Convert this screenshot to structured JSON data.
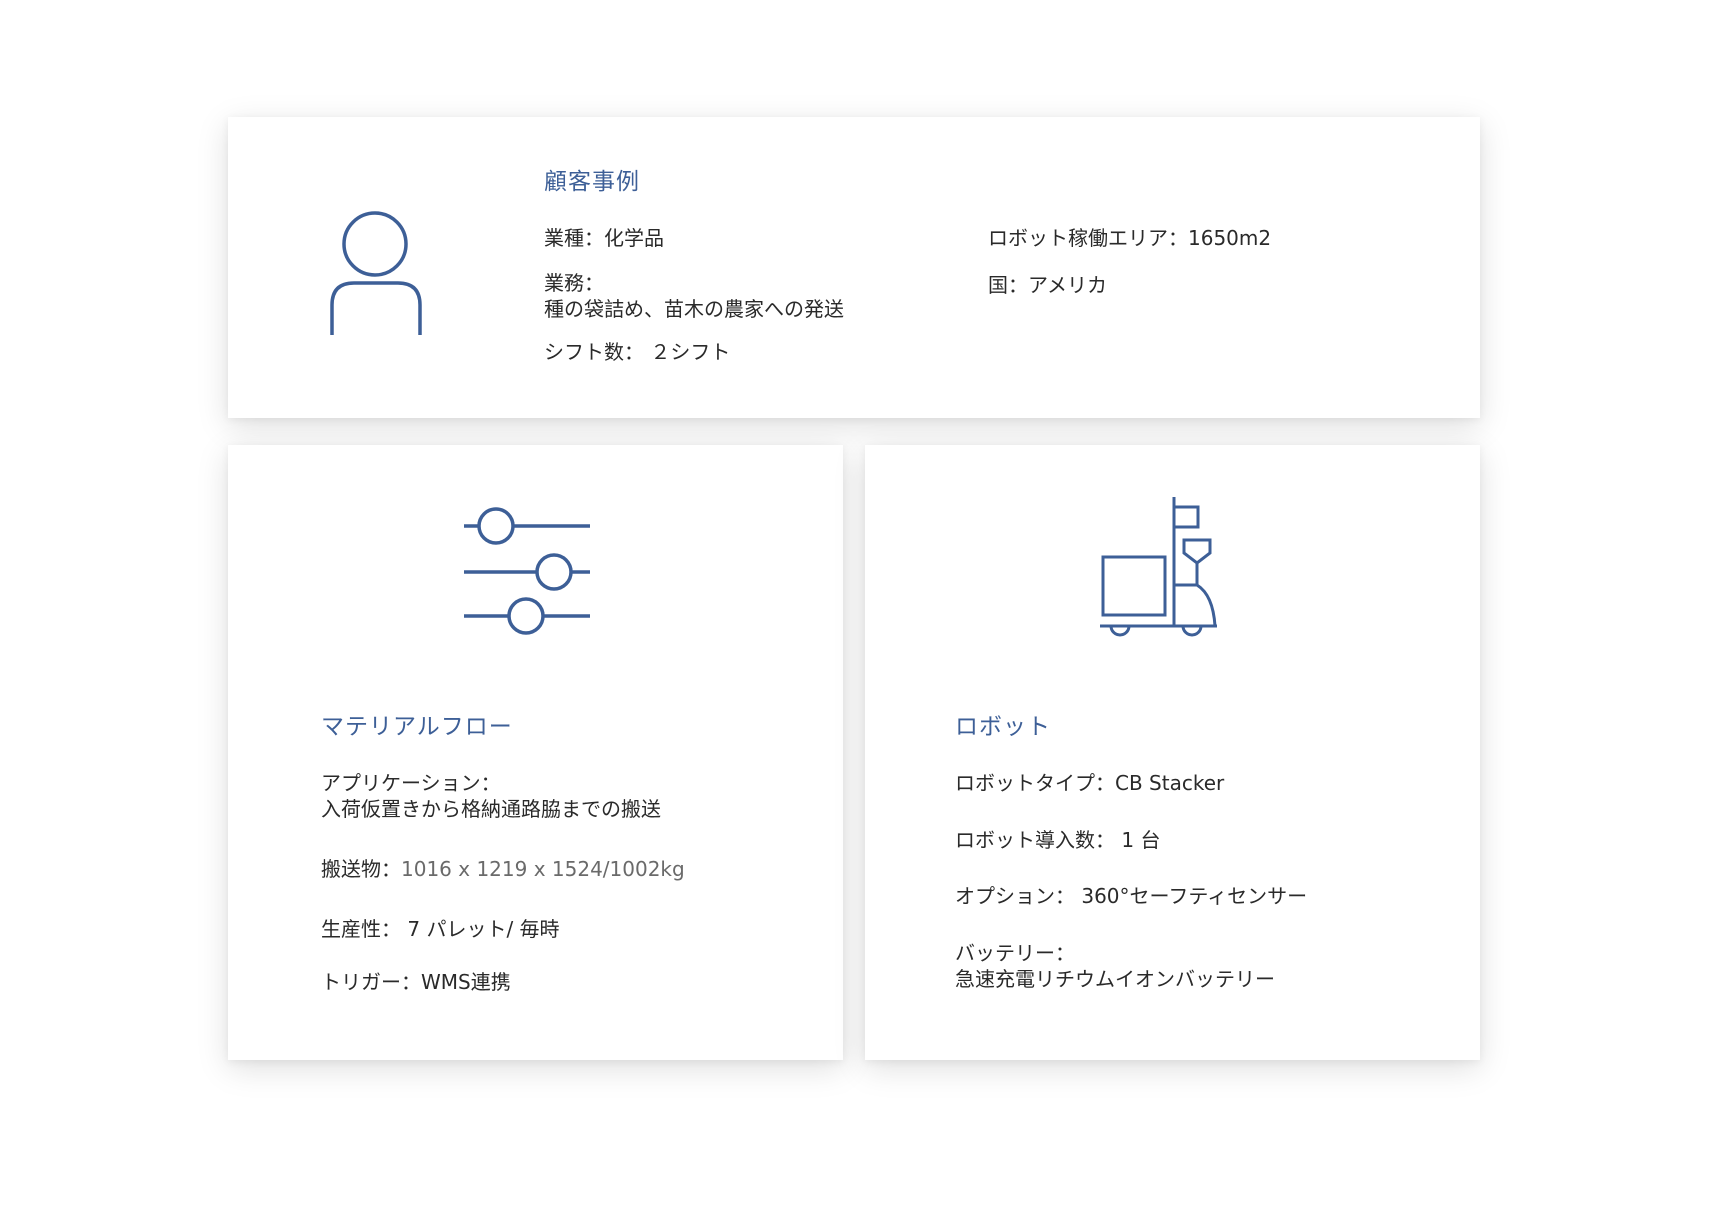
{
  "colors": {
    "accent": "#3d5f97",
    "text": "#2a2a2a",
    "muted": "#6a6a6a"
  },
  "customer": {
    "icon": "person-icon",
    "title": "顧客事例",
    "industry": "業種：化学品",
    "task_label": "業務：",
    "task_value": "種の袋詰め、苗木の農家への発送",
    "shifts": "シフト数： ２シフト",
    "area": "ロボット稼働エリア：1650m2",
    "country": "国：アメリカ"
  },
  "material_flow": {
    "icon": "sliders-icon",
    "title": "マテリアルフロー",
    "application_label": "アプリケーション：",
    "application_value": "入荷仮置きから格納通路脇までの搬送",
    "payload_label": "搬送物：",
    "payload_value": "1016 x 1219 x 1524/1002kg",
    "productivity": "生産性： 7 パレット/ 毎時",
    "trigger": "トリガー：WMS連携"
  },
  "robot": {
    "icon": "forklift-robot-icon",
    "title": "ロボット",
    "type": "ロボットタイプ：CB Stacker",
    "count": "ロボット導入数： 1 台",
    "option": "オプション： 360°セーフティセンサー",
    "battery_label": "バッテリー：",
    "battery_value": "急速充電リチウムイオンバッテリー"
  }
}
